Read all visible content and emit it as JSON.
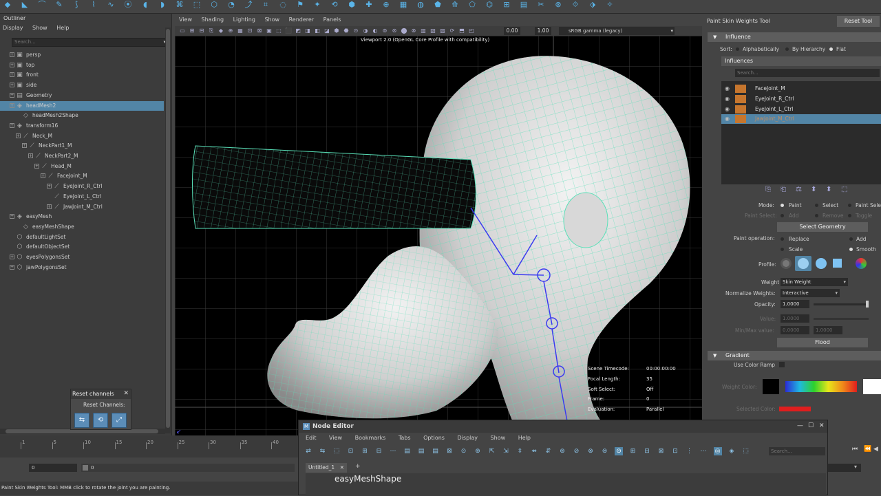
{
  "outliner": {
    "title": "Outliner",
    "menu": [
      "Display",
      "Show",
      "Help"
    ],
    "search_placeholder": "Search...",
    "items": [
      {
        "label": "persp",
        "indent": 0,
        "expand": true,
        "dim": true,
        "icon": "camera-icon"
      },
      {
        "label": "top",
        "indent": 0,
        "expand": true,
        "dim": true,
        "icon": "camera-icon"
      },
      {
        "label": "front",
        "indent": 0,
        "expand": true,
        "dim": true,
        "icon": "camera-icon"
      },
      {
        "label": "side",
        "indent": 0,
        "expand": true,
        "dim": true,
        "icon": "camera-icon"
      },
      {
        "label": "Geometry",
        "indent": 0,
        "expand": true,
        "dim": true,
        "icon": "group-icon"
      },
      {
        "label": "headMesh2",
        "indent": 0,
        "expand": true,
        "selected": true,
        "icon": "mesh-icon"
      },
      {
        "label": "headMesh2Shape",
        "indent": 1,
        "icon": "shape-icon"
      },
      {
        "label": "transform16",
        "indent": 0,
        "expand": true,
        "icon": "mesh-icon"
      },
      {
        "label": "Neck_M",
        "indent": 1,
        "expand": true,
        "icon": "joint-icon"
      },
      {
        "label": "NeckPart1_M",
        "indent": 2,
        "expand": true,
        "icon": "joint-icon"
      },
      {
        "label": "NeckPart2_M",
        "indent": 3,
        "expand": true,
        "icon": "joint-icon"
      },
      {
        "label": "Head_M",
        "indent": 4,
        "expand": true,
        "icon": "joint-icon"
      },
      {
        "label": "FaceJoint_M",
        "indent": 5,
        "expand": true,
        "icon": "joint-icon"
      },
      {
        "label": "EyeJoint_R_Ctrl",
        "indent": 6,
        "expand": true,
        "icon": "joint-icon"
      },
      {
        "label": "EyeJoint_L_Ctrl",
        "indent": 6,
        "icon": "joint-icon"
      },
      {
        "label": "JawJoint_M_Ctrl",
        "indent": 6,
        "expand": true,
        "icon": "joint-icon"
      },
      {
        "label": "easyMesh",
        "indent": 0,
        "expand": true,
        "icon": "mesh-icon"
      },
      {
        "label": "easyMeshShape",
        "indent": 1,
        "icon": "shape-icon"
      },
      {
        "label": "defaultLightSet",
        "indent": 0,
        "icon": "set-icon"
      },
      {
        "label": "defaultObjectSet",
        "indent": 0,
        "icon": "set-icon"
      },
      {
        "label": "eyesPolygonsSet",
        "indent": 0,
        "expand": true,
        "icon": "set-icon"
      },
      {
        "label": "jawPolygonsSet",
        "indent": 0,
        "expand": true,
        "icon": "set-icon"
      }
    ]
  },
  "reset_channels": {
    "title": "Reset channels",
    "subtitle": "Reset Channels:"
  },
  "viewport": {
    "menu": [
      "View",
      "Shading",
      "Lighting",
      "Show",
      "Renderer",
      "Panels"
    ],
    "exposure": "0.00",
    "gamma": "1.00",
    "color_space": "sRGB gamma (legacy)",
    "renderer_label": "Viewport 2.0 (OpenGL Core Profile with compatibility)",
    "hud": [
      {
        "label": "Scene Timecode:",
        "value": "00:00:00:00"
      },
      {
        "label": "Focal Length:",
        "value": "35"
      },
      {
        "label": "Soft Select:",
        "value": "Off"
      },
      {
        "label": "Frame:",
        "value": "0"
      },
      {
        "label": "Evaluation:",
        "value": "Parallel"
      }
    ]
  },
  "tool_panel": {
    "title": "Paint Skin Weights Tool",
    "reset_label": "Reset Tool",
    "influence_section": "Influence",
    "sort_label": "Sort:",
    "sort_options": [
      "Alphabetically",
      "By Hierarchy",
      "Flat"
    ],
    "influences_header": "Influences",
    "search_placeholder": "Search...",
    "influences": [
      "FaceJoint_M",
      "EyeJoint_R_Ctrl",
      "EyeJoint_L_Ctrl",
      "JawJoint_M_Ctrl"
    ],
    "mode_label": "Mode:",
    "mode_options": [
      "Paint",
      "Select",
      "Paint Sele"
    ],
    "paint_select_label": "Paint Select:",
    "paint_select_options": [
      "Add",
      "Remove",
      "Toggle"
    ],
    "select_geometry": "Select Geometry",
    "paint_op_label": "Paint operation:",
    "paint_ops": [
      "Replace",
      "Add",
      "Scale",
      "Smooth"
    ],
    "profile_label": "Profile:",
    "weight_type_label": "Weight Type:",
    "weight_type": "Skin Weight",
    "normalize_label": "Normalize Weights:",
    "normalize_value": "Interactive",
    "opacity_label": "Opacity:",
    "opacity_value": "1.0000",
    "value_label": "Value:",
    "value_value": "1.0000",
    "minmax_label": "Min/Max value:",
    "min_value": "0.0000",
    "max_value": "1.0000",
    "flood_label": "Flood",
    "gradient_section": "Gradient",
    "use_color_ramp": "Use Color Ramp",
    "weight_color_label": "Weight Color:",
    "selected_color_label": "Selected Color:",
    "opacity_level": 0.98
  },
  "node_editor": {
    "title": "Node Editor",
    "menu": [
      "Edit",
      "View",
      "Bookmarks",
      "Tabs",
      "Options",
      "Display",
      "Show",
      "Help"
    ],
    "search_placeholder": "Search...",
    "tab_label": "Untitled_1",
    "node_name": "easyMeshShape"
  },
  "timeline": {
    "ticks": [
      "1",
      "5",
      "10",
      "15",
      "20",
      "25",
      "30",
      "35",
      "40",
      "45"
    ],
    "range_start": "0",
    "range_inner": "0"
  },
  "status_line": "Paint Skin Weights Tool: MMB click to rotate the joint you are painting."
}
